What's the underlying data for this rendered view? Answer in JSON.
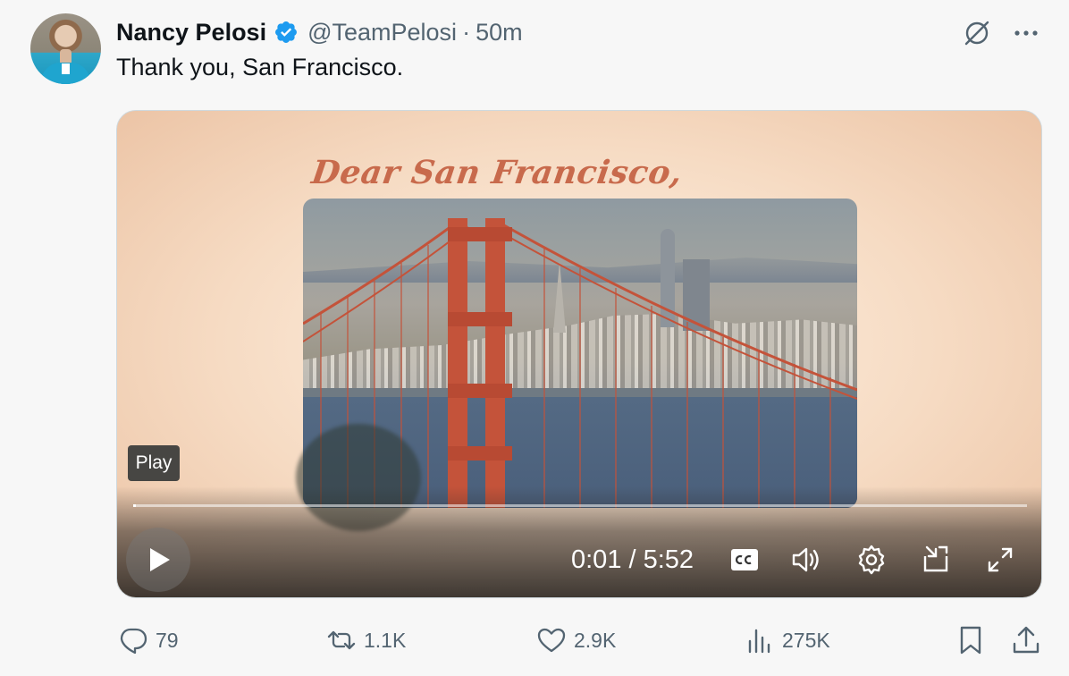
{
  "tweet": {
    "author_name": "Nancy Pelosi",
    "handle": "@TeamPelosi",
    "separator": "·",
    "time_ago": "50m",
    "text": "Thank you, San Francisco.",
    "verified_badge": "verified-badge-icon",
    "colors": {
      "verified": "#1d9bf0",
      "secondary_text": "#536471",
      "primary_text": "#0f1419"
    }
  },
  "media": {
    "title_text": "Dear San Francisco,",
    "tooltip": "Play",
    "time_readout": "0:01 / 5:52",
    "progress_fraction": 0.003,
    "controls": [
      "play-icon",
      "cc-icon",
      "volume-icon",
      "settings-icon",
      "picture-in-picture-icon",
      "fullscreen-icon"
    ]
  },
  "actions": {
    "replies": "79",
    "retweets": "1.1K",
    "likes": "2.9K",
    "views": "275K"
  }
}
